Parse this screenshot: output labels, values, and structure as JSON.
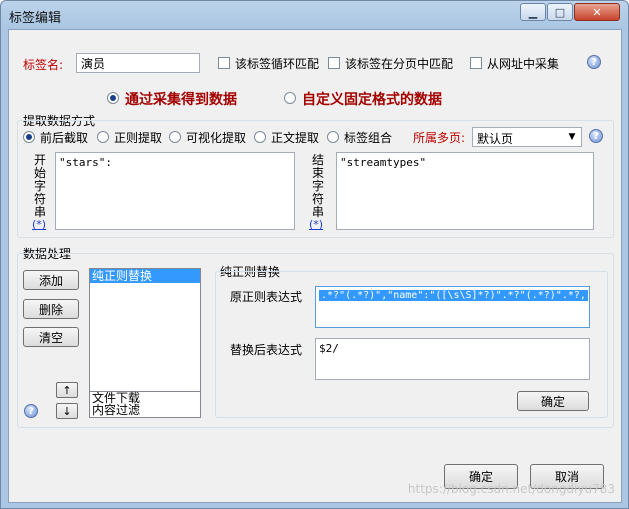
{
  "window": {
    "title": "标签编辑",
    "controls": {
      "minimize": "▁",
      "maximize": "□",
      "close": "✕"
    }
  },
  "tag": {
    "name_label": "标签名:",
    "name_value": "演员",
    "options": [
      {
        "label": "该标签循环匹配",
        "checked": false
      },
      {
        "label": "该标签在分页中匹配",
        "checked": false
      },
      {
        "label": "从网址中采集",
        "checked": false
      }
    ]
  },
  "mode": {
    "collect": {
      "label": "通过采集得到数据",
      "selected": true
    },
    "custom": {
      "label": "自定义固定格式的数据",
      "selected": false
    }
  },
  "extract": {
    "group_label": "提取数据方式",
    "methods": [
      {
        "label": "前后截取",
        "selected": true
      },
      {
        "label": "正则提取",
        "selected": false
      },
      {
        "label": "可视化提取",
        "selected": false
      },
      {
        "label": "正文提取",
        "selected": false
      },
      {
        "label": "标签组合",
        "selected": false
      }
    ],
    "page_label": "所属多页:",
    "page_value": "默认页",
    "start_label": "开始字符串",
    "start_value": "\"stars\":",
    "end_label": "结束字符串",
    "end_value": "\"streamtypes\"",
    "wildcard": "(*)"
  },
  "processing": {
    "group_label": "数据处理",
    "buttons": {
      "add": "添加",
      "delete": "删除",
      "clear": "清空",
      "up": "↑",
      "down": "↓"
    },
    "list_items": [
      {
        "label": "纯正则替换",
        "selected": true
      }
    ],
    "bottom_items": [
      "文件下载",
      "内容过滤"
    ],
    "detail": {
      "title": "纯正则替换",
      "source_label": "原正则表达式",
      "source_value": ".*?\"(.*?)\",\"name\":\"([\\s\\S]*?)\".*?\"(.*?)\".*?,",
      "target_label": "替换后表达式",
      "target_value": "$2/",
      "confirm": "确定"
    }
  },
  "footer": {
    "ok": "确定",
    "cancel": "取消",
    "watermark": "https://blog.csdn.net/dongdiyu783"
  },
  "icon_help": "?"
}
